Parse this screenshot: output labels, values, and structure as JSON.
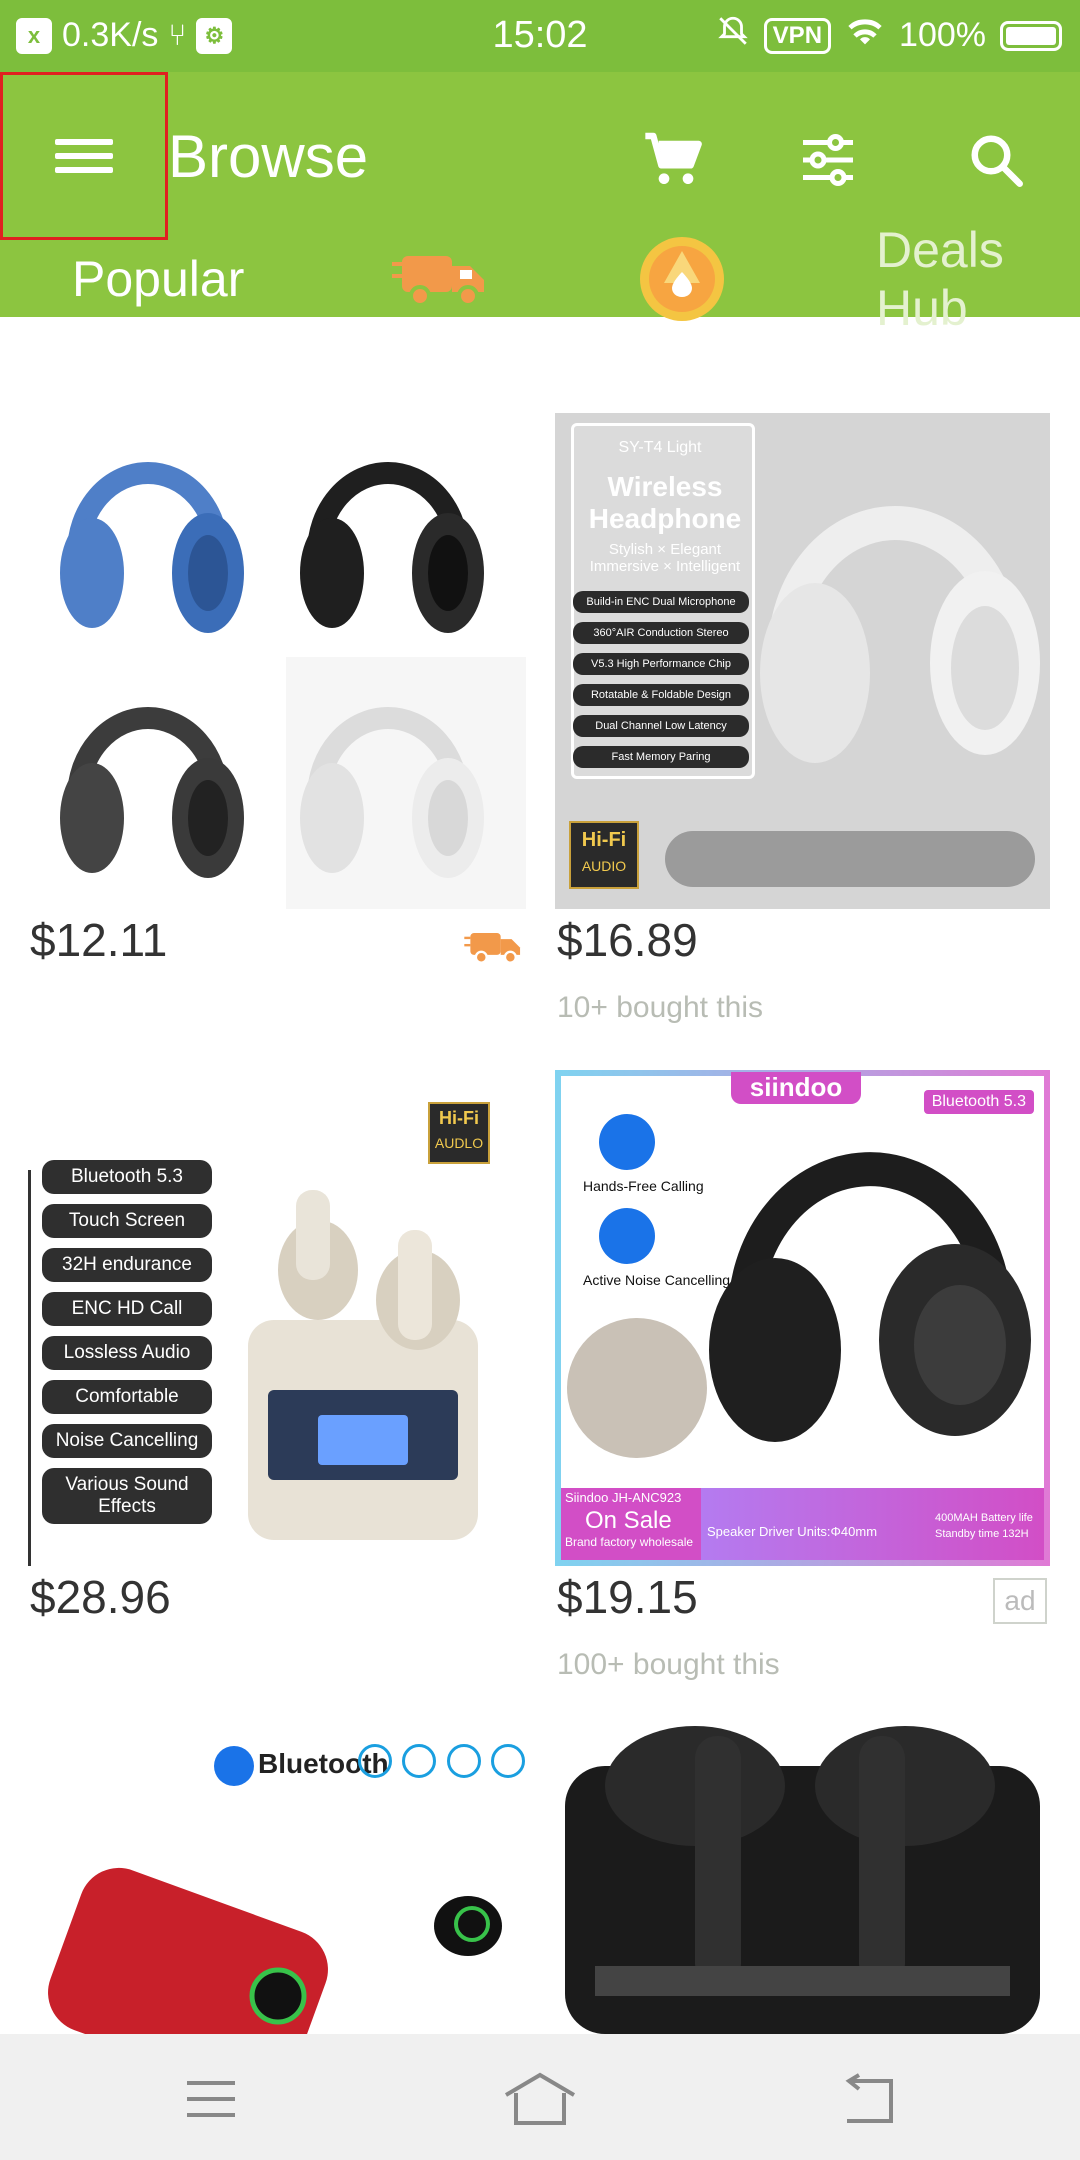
{
  "status": {
    "speed": "0.3K/s",
    "time": "15:02",
    "vpn": "VPN",
    "battery": "100%"
  },
  "header": {
    "title": "Browse"
  },
  "tabs": {
    "popular": "Popular",
    "deals": "Deals Hub"
  },
  "products": [
    {
      "price": "$12.11",
      "bought": "",
      "free_shipping": true
    },
    {
      "price": "$16.89",
      "bought": "10+ bought this",
      "title": "Wireless Headphone",
      "model": "SY-T4 Light",
      "tagline": "Stylish × Elegant Immersive × Intelligent",
      "features": [
        "Build-in ENC Dual Microphone",
        "360°AIR Conduction Stereo",
        "V5.3 High Performance Chip",
        "Rotatable & Foldable Design",
        "Dual Channel Low Latency",
        "Fast Memory Paring"
      ],
      "hifi": "Hi-Fi",
      "hifi_sub": "AUDIO"
    },
    {
      "price": "$28.96",
      "bought": "",
      "hifi": "Hi-Fi",
      "hifi_sub": "AUDLO",
      "features": [
        "Bluetooth 5.3",
        "Touch Screen",
        "32H endurance",
        "ENC HD Call",
        "Lossless Audio",
        "Comfortable",
        "Noise Cancelling",
        "Various Sound Effects"
      ]
    },
    {
      "price": "$19.15",
      "bought": "100+ bought this",
      "ad": "ad",
      "brand": "siindoo",
      "bt": "Bluetooth 5.3",
      "feat1": "Hands-Free Calling",
      "feat2": "Active Noise Cancelling",
      "model": "Siindoo JH-ANC923",
      "sale": "On Sale",
      "sale_sub": "Brand factory wholesale",
      "driver": "Speaker Driver Units:Φ40mm",
      "battery": "400MAH Battery life Standby time 132H"
    },
    {
      "bt_label": "Bluetooth"
    },
    {}
  ]
}
